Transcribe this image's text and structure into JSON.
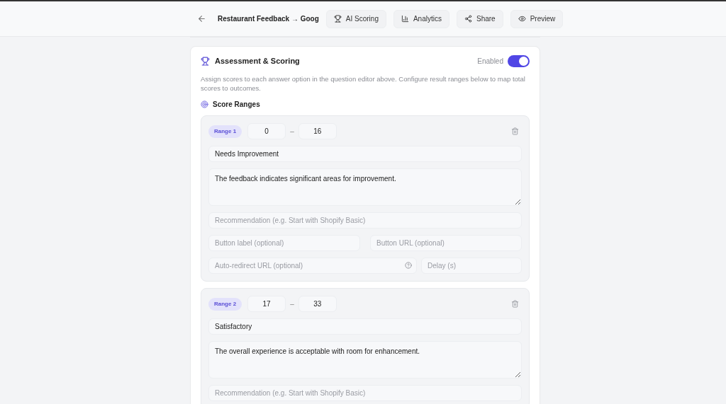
{
  "header": {
    "title": "Restaurant Feedback → Goog",
    "buttons": [
      {
        "kind": "trophy",
        "label": "AI Scoring"
      },
      {
        "kind": "chart",
        "label": "Analytics"
      },
      {
        "kind": "share",
        "label": "Share"
      },
      {
        "kind": "eye",
        "label": "Preview"
      }
    ]
  },
  "scoring": {
    "title": "Assessment & Scoring",
    "toggle_label": "Enabled",
    "enabled": true,
    "description": "Assign scores to each answer option in the question editor above. Configure result ranges below to map total scores to outcomes.",
    "ranges_title": "Score Ranges",
    "ranges": [
      {
        "label": "Range 1",
        "min": "0",
        "separator": "–",
        "max": "16",
        "name": "Needs Improvement",
        "description": "The feedback indicates significant areas for improvement.",
        "recommendation_placeholder": "Recommendation (e.g. Start with Shopify Basic)",
        "button_label_placeholder": "Button label (optional)",
        "button_url_placeholder": "Button URL (optional)",
        "redirect_placeholder": "Auto-redirect URL (optional)",
        "delay_placeholder": "Delay (s)"
      },
      {
        "label": "Range 2",
        "min": "17",
        "separator": "–",
        "max": "33",
        "name": "Satisfactory",
        "description": "The overall experience is acceptable with room for enhancement.",
        "recommendation_placeholder": "Recommendation (e.g. Start with Shopify Basic)"
      }
    ]
  }
}
